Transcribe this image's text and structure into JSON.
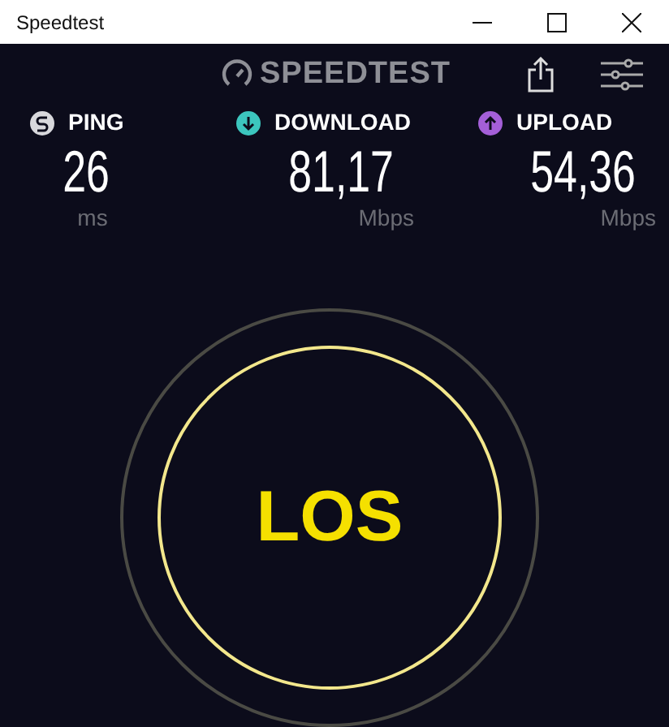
{
  "window": {
    "title": "Speedtest"
  },
  "header": {
    "logo": "SPEEDTEST"
  },
  "metrics": [
    {
      "kind": "ping",
      "label": "PING",
      "value": "26",
      "unit": "ms",
      "color": "#d8d8dc"
    },
    {
      "kind": "download",
      "label": "DOWNLOAD",
      "value": "81,17",
      "unit": "Mbps",
      "color": "#3cc6be"
    },
    {
      "kind": "upload",
      "label": "UPLOAD",
      "value": "54,36",
      "unit": "Mbps",
      "color": "#a45fd8"
    }
  ],
  "start_button": {
    "label": "LOS"
  }
}
